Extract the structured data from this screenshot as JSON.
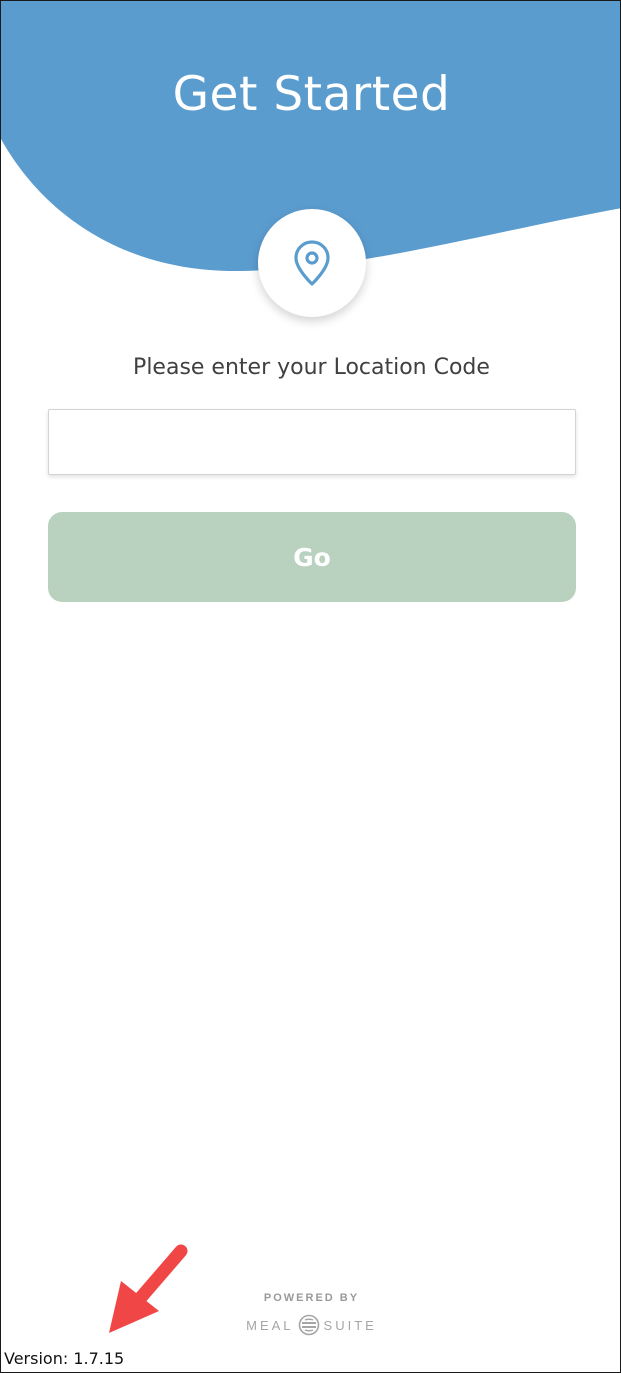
{
  "header": {
    "title": "Get Started",
    "background_color": "#5b9ccf",
    "location_icon": "map-pin-icon"
  },
  "form": {
    "prompt": "Please enter your Location Code",
    "code_value": "",
    "code_placeholder": "",
    "go_label": "Go",
    "go_button_color": "#b9d2bf"
  },
  "footer": {
    "powered_by": "POWERED BY",
    "brand_left": "MEAL",
    "brand_right": "SUITE",
    "brand_icon": "mealsuite-logo-icon",
    "version": "Version: 1.7.15"
  },
  "annotation": {
    "icon": "arrow-pointer-icon",
    "color": "#f04646"
  }
}
